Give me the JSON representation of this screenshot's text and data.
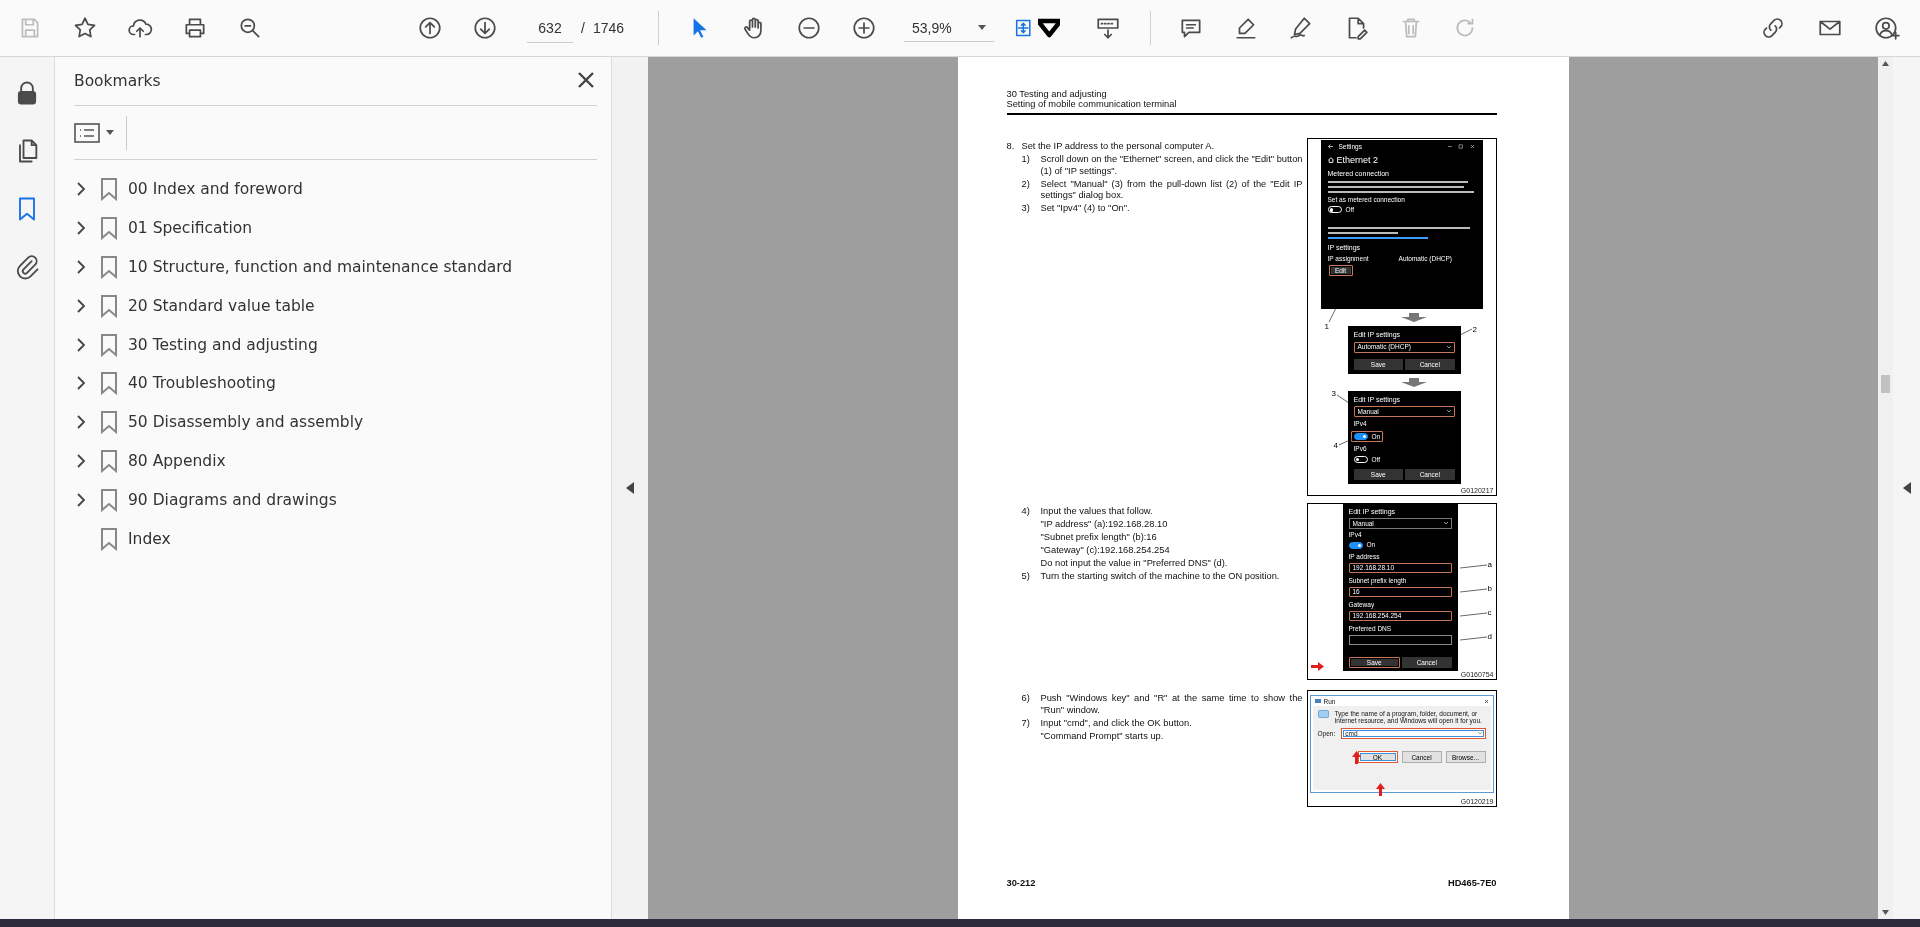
{
  "toolbar": {
    "file_tools": [
      {
        "kind": "save",
        "disabled": true
      },
      {
        "kind": "star",
        "disabled": false
      },
      {
        "kind": "upload",
        "disabled": false
      },
      {
        "kind": "print",
        "disabled": false
      },
      {
        "kind": "find",
        "disabled": false
      }
    ],
    "nav_tools": [
      {
        "kind": "prev-page",
        "disabled": false
      },
      {
        "kind": "next-page",
        "disabled": false
      }
    ],
    "page": {
      "value": "632",
      "separator": "/",
      "total": "1746"
    },
    "mode_tools": [
      {
        "kind": "pointer",
        "selected": true
      },
      {
        "kind": "hand",
        "selected": false
      },
      {
        "kind": "zoom-out",
        "selected": false
      },
      {
        "kind": "zoom-in",
        "selected": false
      }
    ],
    "zoom": "53,9%",
    "view_tools": [
      {
        "kind": "fit",
        "disabled": false
      },
      {
        "kind": "read",
        "disabled": false
      }
    ],
    "edit_tools": [
      {
        "kind": "comment",
        "disabled": false
      },
      {
        "kind": "highlight",
        "disabled": false
      },
      {
        "kind": "sign",
        "disabled": false
      },
      {
        "kind": "fill-sign",
        "disabled": false
      },
      {
        "kind": "delete",
        "disabled": true
      },
      {
        "kind": "redo",
        "disabled": true
      }
    ],
    "account_tools": [
      {
        "kind": "share",
        "disabled": false
      },
      {
        "kind": "mail",
        "disabled": false
      },
      {
        "kind": "account",
        "disabled": false
      }
    ]
  },
  "rail": [
    {
      "kind": "lock",
      "selected": false
    },
    {
      "kind": "pages",
      "selected": false
    },
    {
      "kind": "bookmarks",
      "selected": true
    },
    {
      "kind": "attachments",
      "selected": false
    }
  ],
  "bookmarks": {
    "title": "Bookmarks",
    "items": [
      {
        "label": "00 Index and foreword",
        "has_children": true,
        "expanded": false
      },
      {
        "label": "01 Specification",
        "has_children": true,
        "expanded": false
      },
      {
        "label": "10 Structure, function and maintenance standard",
        "has_children": true,
        "expanded": false
      },
      {
        "label": "20 Standard value table",
        "has_children": true,
        "expanded": false
      },
      {
        "label": "30 Testing and adjusting",
        "has_children": true,
        "expanded": false
      },
      {
        "label": "40 Troubleshooting",
        "has_children": true,
        "expanded": false
      },
      {
        "label": "50 Disassembly and assembly",
        "has_children": true,
        "expanded": false
      },
      {
        "label": "80 Appendix",
        "has_children": true,
        "expanded": false
      },
      {
        "label": "90 Diagrams and drawings",
        "has_children": true,
        "expanded": false
      },
      {
        "label": "Index",
        "has_children": false,
        "expanded": false
      }
    ]
  },
  "document": {
    "header": [
      "30 Testing and adjusting",
      "Setting of mobile communication terminal"
    ],
    "blocks": [
      {
        "items": [
          {
            "kind": "step",
            "num": "8.",
            "text": "Set the IP address to the personal computer A."
          },
          {
            "kind": "substep",
            "num": "1)",
            "text": "Scroll down on the \"Ethernet\" screen, and click the \"Edit\" button (1) of \"IP settings\"."
          },
          {
            "kind": "substep",
            "num": "2)",
            "text": "Select \"Manual\" (3) from the pull-down list (2) of the \"Edit IP settings\" dialog box."
          },
          {
            "kind": "substep",
            "num": "3)",
            "text": "Set \"Ipv4\" (4) to \"On\"."
          }
        ],
        "figure": {
          "kind": "settings-steps",
          "window": {
            "title": "Settings",
            "heading": "Ethernet 2",
            "section": "Metered connection",
            "toggle_label": "Set as metered connection",
            "toggle": {
              "on": false,
              "text": "Off"
            },
            "ip_heading": "IP settings",
            "ip_label": "IP assignment",
            "ip_value": "Automatic (DHCP)",
            "edit_button": {
              "label": "Edit",
              "highlighted": true
            }
          },
          "dialogs": [
            {
              "title": "Edit IP settings",
              "dropdown": {
                "value": "Automatic (DHCP)",
                "highlighted": true
              },
              "buttons": [
                "Save",
                "Cancel"
              ]
            },
            {
              "title": "Edit IP settings",
              "dropdown": {
                "value": "Manual",
                "highlighted": true
              },
              "toggles": [
                {
                  "label": "IPv4",
                  "on": true,
                  "text": "On",
                  "highlighted": true
                },
                {
                  "label": "IPv6",
                  "on": false,
                  "text": "Off",
                  "highlighted": false
                }
              ],
              "buttons": [
                "Save",
                "Cancel"
              ]
            }
          ],
          "callouts": [
            "1",
            "2",
            "3",
            "4"
          ],
          "figure_id": "G0120217"
        }
      },
      {
        "items": [
          {
            "kind": "substep",
            "num": "4)",
            "text": "Input the values that follow."
          },
          {
            "kind": "line",
            "text": "\"IP address\" (a):192.168.28.10"
          },
          {
            "kind": "line",
            "text": "\"Subnet prefix length\" (b):16"
          },
          {
            "kind": "line",
            "text": "\"Gateway\" (c):192.168.254.254"
          },
          {
            "kind": "line",
            "text": "Do not input the value in \"Preferred DNS\" (d)."
          },
          {
            "kind": "substep",
            "num": "5)",
            "text": "Turn the starting switch of the machine to the ON position."
          }
        ],
        "figure": {
          "kind": "ip-form",
          "title": "Edit IP settings",
          "dropdown": {
            "value": "Manual",
            "highlighted": false
          },
          "toggle": {
            "label": "IPv4",
            "on": true,
            "text": "On"
          },
          "fields": [
            {
              "label": "IP address",
              "value": "192.168.28.10",
              "callout": "a",
              "highlighted": true
            },
            {
              "label": "Subnet prefix length",
              "value": "16",
              "callout": "b",
              "highlighted": true
            },
            {
              "label": "Gateway",
              "value": "192.168.254.254",
              "callout": "c",
              "highlighted": true
            },
            {
              "label": "Preferred DNS",
              "callout": "d",
              "highlighted": false
            }
          ],
          "buttons": [
            {
              "label": "Save",
              "highlighted": true
            },
            {
              "label": "Cancel",
              "highlighted": false
            }
          ],
          "figure_id": "G0160754"
        }
      },
      {
        "items": [
          {
            "kind": "substep",
            "num": "6)",
            "text": "Push \"Windows key\" and \"R\" at the same time to show the \"Run\" window."
          },
          {
            "kind": "substep",
            "num": "7)",
            "text": "Input \"cmd\", and click the OK button."
          },
          {
            "kind": "line",
            "text": "\"Command Prompt\" starts up."
          }
        ],
        "figure": {
          "kind": "run-dialog",
          "title": "Run",
          "description": "Type the name of a program, folder, document, or Internet resource, and Windows will open it for you.",
          "open_label": "Open:",
          "value": "cmd",
          "buttons": [
            {
              "label": "OK",
              "highlighted": true
            },
            {
              "label": "Cancel",
              "highlighted": false
            },
            {
              "label": "Browse...",
              "highlighted": false
            }
          ],
          "figure_id": "G0120219"
        }
      }
    ],
    "footer": {
      "page": "30-212",
      "model": "HD465-7E0"
    }
  }
}
